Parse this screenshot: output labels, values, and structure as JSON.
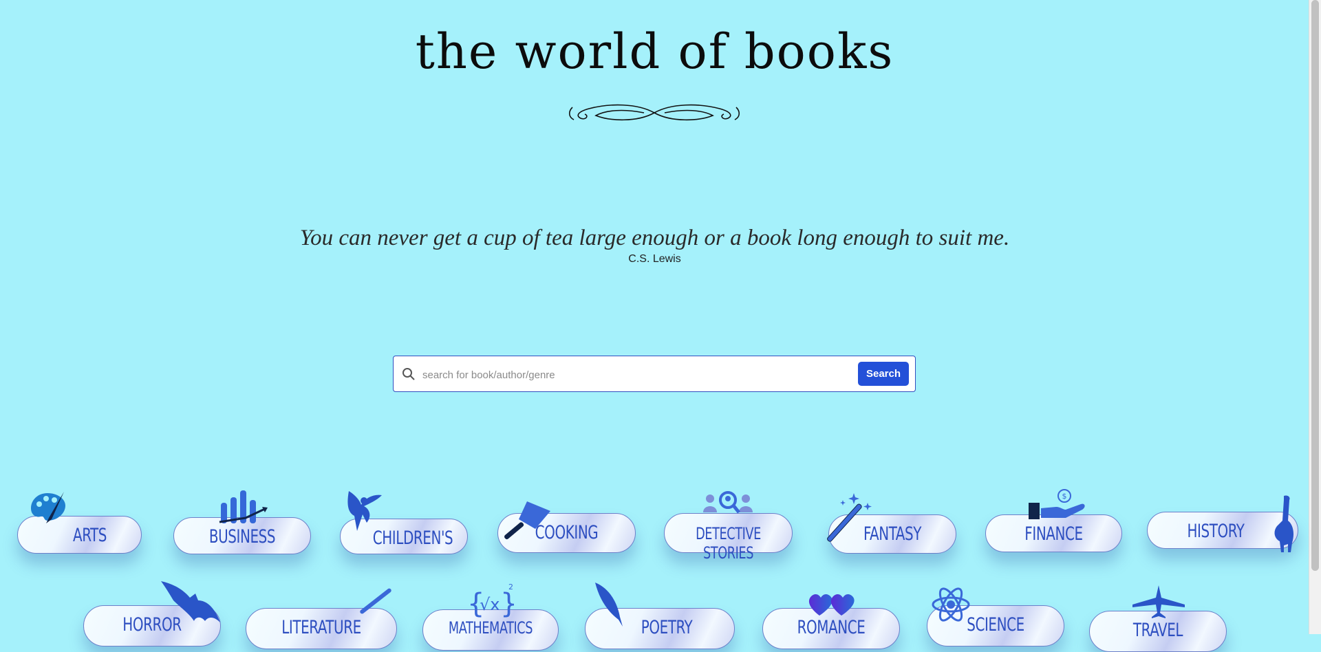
{
  "header": {
    "title": "the world of books"
  },
  "quote": {
    "text": "You can never get a cup of tea large enough or a book long enough to suit me.",
    "author": "C.S. Lewis"
  },
  "search": {
    "placeholder": "search for book/author/genre",
    "value": "",
    "button_label": "Search"
  },
  "genres": [
    {
      "label": "ARTS",
      "icon": "palette-icon"
    },
    {
      "label": "BUSINESS",
      "icon": "bar-chart-icon"
    },
    {
      "label": "CHILDREN'S",
      "icon": "fairy-icon"
    },
    {
      "label": "COOKING",
      "icon": "cleaver-icon"
    },
    {
      "label": "DETECTIVE STORIES",
      "icon": "magnifier-people-icon"
    },
    {
      "label": "FANTASY",
      "icon": "magic-wand-icon"
    },
    {
      "label": "FINANCE",
      "icon": "hand-coin-icon"
    },
    {
      "label": "HISTORY",
      "icon": "dinosaur-icon"
    },
    {
      "label": "HORROR",
      "icon": "bat-icon"
    },
    {
      "label": "LITERATURE",
      "icon": "pen-icon"
    },
    {
      "label": "MATHEMATICS",
      "icon": "square-root-icon"
    },
    {
      "label": "POETRY",
      "icon": "quill-icon"
    },
    {
      "label": "ROMANCE",
      "icon": "hearts-icon"
    },
    {
      "label": "SCIENCE",
      "icon": "atom-icon"
    },
    {
      "label": "TRAVEL",
      "icon": "airplane-icon"
    }
  ],
  "colors": {
    "background": "#a5f1fb",
    "accent": "#2350d8",
    "genre_text": "#2d4ec0"
  }
}
